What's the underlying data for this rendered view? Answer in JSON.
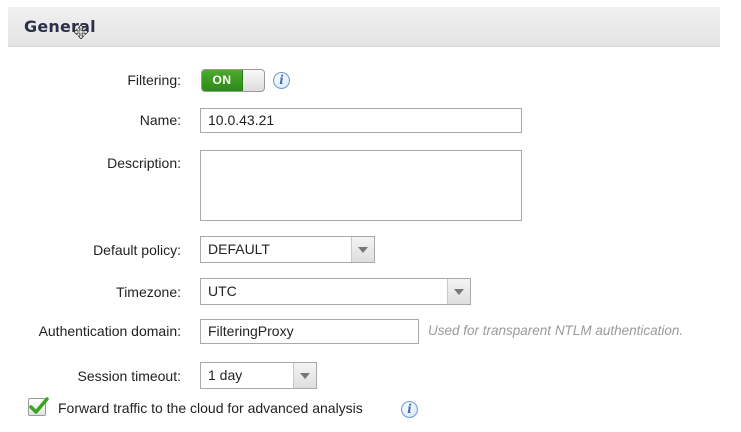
{
  "section": {
    "title": "General"
  },
  "labels": {
    "filtering": "Filtering:",
    "name": "Name:",
    "description": "Description:",
    "default_policy": "Default policy:",
    "timezone": "Timezone:",
    "auth_domain": "Authentication domain:",
    "session_timeout": "Session timeout:"
  },
  "filtering": {
    "state": "ON"
  },
  "fields": {
    "name": "10.0.43.21",
    "description": "",
    "auth_domain": "FilteringProxy"
  },
  "selects": {
    "default_policy": "DEFAULT",
    "timezone": "UTC",
    "session_timeout": "1 day"
  },
  "hints": {
    "auth_domain": "Used for transparent NTLM authentication."
  },
  "checkbox": {
    "label": "Forward traffic to the cloud for advanced analysis",
    "checked": true
  },
  "icons": {
    "info": "i"
  },
  "colors": {
    "toggle_on": "#2c8a17",
    "checkmark": "#3aa324",
    "info": "#3d6fb8"
  }
}
